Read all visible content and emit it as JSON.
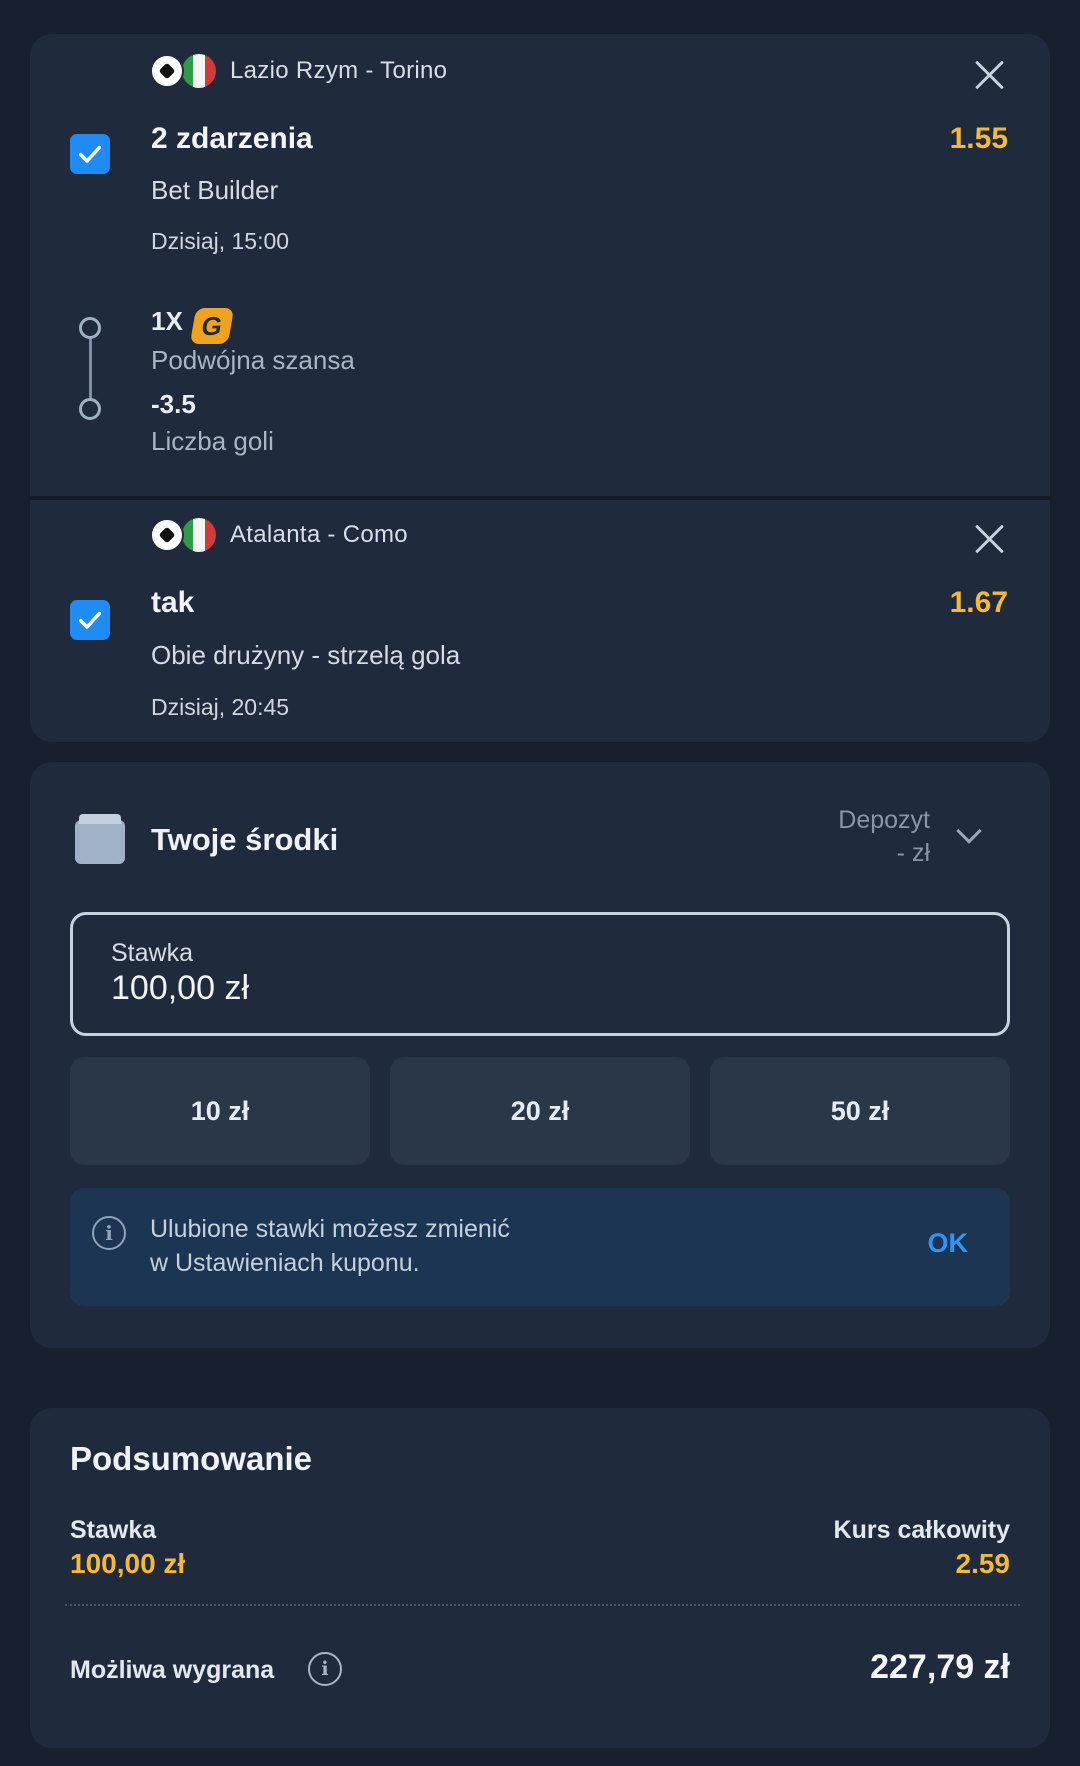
{
  "bets": [
    {
      "match": "Lazio Rzym - Torino",
      "selection": "2 zdarzenia",
      "odds": "1.55",
      "market": "Bet Builder",
      "time": "Dzisiaj, 15:00",
      "legs": [
        {
          "value": "1X",
          "name": "Podwójna szansa",
          "badge": "G"
        },
        {
          "value": "-3.5",
          "name": "Liczba goli"
        }
      ]
    },
    {
      "match": "Atalanta - Como",
      "selection": "tak",
      "odds": "1.67",
      "market": "Obie drużyny - strzelą gola",
      "time": "Dzisiaj, 20:45"
    }
  ],
  "funds": {
    "title": "Twoje środki",
    "deposit_label": "Depozyt",
    "deposit_value": "- zł",
    "stake_label": "Stawka",
    "stake_value": "100,00 zł",
    "chips": [
      "10 zł",
      "20 zł",
      "50 zł"
    ],
    "info_line1": "Ulubione stawki możesz zmienić",
    "info_line2": "w Ustawieniach kuponu.",
    "info_ok": "OK"
  },
  "summary": {
    "title": "Podsumowanie",
    "stake_label": "Stawka",
    "stake_value": "100,00 zł",
    "total_odds_label": "Kurs całkowity",
    "total_odds_value": "2.59",
    "win_label": "Możliwa wygrana",
    "win_value": "227,79 zł"
  },
  "colors": {
    "accent": "#1e8cf4",
    "odds": "#f5b936",
    "background": "#16202f",
    "card": "#1f2b3c"
  },
  "icons": [
    "football-icon",
    "italy-flag-icon",
    "close-icon",
    "checkbox-checked-icon",
    "g-badge-icon",
    "wallet-icon",
    "chevron-down-icon",
    "info-icon"
  ]
}
